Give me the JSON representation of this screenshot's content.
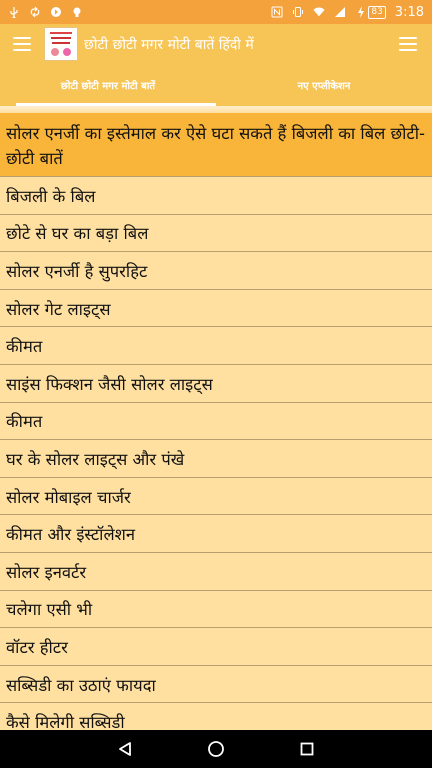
{
  "status_bar": {
    "time": "3:18",
    "battery": "83",
    "icons_left": [
      "usb-icon",
      "sync-icon",
      "app-icon",
      "bulb-icon"
    ],
    "icons_right": [
      "nfc-icon",
      "vibrate-icon",
      "wifi-icon",
      "signal-icon",
      "battery-icon"
    ]
  },
  "app_bar": {
    "title": "छोटी छोटी मगर मोटी बातें हिंदी में"
  },
  "tabs": [
    {
      "label": "छोटी छोटी मगर मोटी बातें",
      "active": true
    },
    {
      "label": "नए एप्लीकेशन",
      "active": false
    }
  ],
  "list": {
    "highlighted": "सोलर एनर्जी का इस्तेमाल कर ऐसे घटा सकते हैं बिजली का बिल छोटी-छोटी बातें",
    "items": [
      "बिजली के बिल",
      "छोटे से घर का बड़ा बिल",
      "सोलर एनर्जी है सुपरहिट",
      "सोलर गेट लाइट्स",
      "कीमत",
      "साइंस फिक्शन जैसी सोलर लाइट्स",
      "कीमत",
      "घर के सोलर लाइट्स और पंखे",
      "सोलर मोबाइल चार्जर",
      "कीमत और इंस्टॉलेशन",
      "सोलर इनवर्टर",
      "चलेगा एसी भी",
      "वॉटर हीटर",
      "सब्सिडी का उठाएं फायदा",
      "कैसे मिलेगी सब्सिडी"
    ]
  },
  "colors": {
    "status_bar": "#f3a23c",
    "app_bar": "#f7c556",
    "list_bg": "#ffe0a0",
    "highlight": "#f9b43a"
  }
}
